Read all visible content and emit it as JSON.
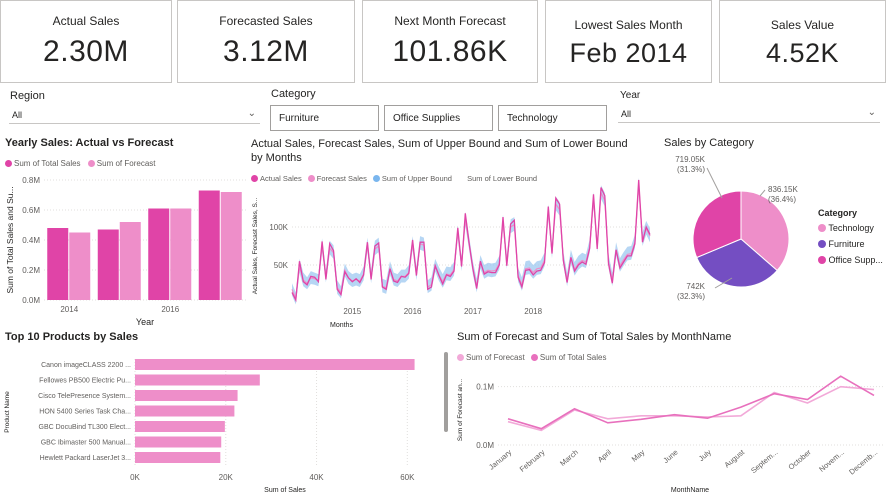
{
  "cards": [
    {
      "label": "Actual Sales",
      "value": "2.30M"
    },
    {
      "label": "Forecasted Sales",
      "value": "3.12M"
    },
    {
      "label": "Next Month Forecast",
      "value": "101.86K"
    },
    {
      "label": "Lowest Sales Month",
      "value": "Feb 2014"
    },
    {
      "label": "Sales Value",
      "value": "4.52K"
    }
  ],
  "slicers": {
    "region": {
      "title": "Region",
      "value": "All"
    },
    "category": {
      "title": "Category",
      "buttons": [
        "Furniture",
        "Office Supplies",
        "Technology"
      ]
    },
    "year": {
      "title": "Year",
      "value": "All"
    }
  },
  "icons": {
    "dropdown": "chevron-down-icon"
  },
  "colors": {
    "actual": "#e044a7",
    "forecast": "#ee8ec9",
    "upper": "#9dc8f0",
    "technology": "#ee8ec9",
    "furniture": "#744ec2",
    "office": "#e044a7"
  },
  "yearly": {
    "title": "Yearly Sales: Actual vs Forecast",
    "legend": [
      "Sum of Total Sales",
      "Sum of Forecast"
    ],
    "ylabel": "Sum of Total Sales and Su...",
    "xlabel": "Year",
    "yticks": [
      "0.0M",
      "0.2M",
      "0.4M",
      "0.6M",
      "0.8M"
    ],
    "xticks": [
      "2014",
      "2016"
    ]
  },
  "monthly": {
    "title": "Actual Sales, Forecast Sales, Sum of Upper Bound and Sum of Lower Bound by Months",
    "legend": [
      "Actual Sales",
      "Forecast Sales",
      "Sum of Upper Bound",
      "Sum of Lower Bound"
    ],
    "ylabel": "Actual Sales, Forecast Sales, S...",
    "xlabel": "Months",
    "yticks": [
      "50K",
      "100K"
    ],
    "xticks": [
      "2015",
      "2016",
      "2017",
      "2018"
    ]
  },
  "pie": {
    "title": "Sales by Category",
    "legend_title": "Category",
    "legend": [
      "Technology",
      "Furniture",
      "Office Supp..."
    ],
    "labels": [
      {
        "value": "836.15K",
        "pct": "(36.4%)"
      },
      {
        "value": "742K",
        "pct": "(32.3%)"
      },
      {
        "value": "719.05K",
        "pct": "(31.3%)"
      }
    ]
  },
  "top10": {
    "title": "Top 10 Products by Sales",
    "ylabel": "Product Name",
    "xlabel": "Sum of Sales",
    "xticks": [
      "0K",
      "20K",
      "40K",
      "60K"
    ]
  },
  "bymonth": {
    "title": "Sum of Forecast and Sum of Total Sales by MonthName",
    "legend": [
      "Sum of Forecast",
      "Sum of Total Sales"
    ],
    "ylabel": "Sum of Forecast an...",
    "xlabel": "MonthName",
    "yticks": [
      "0.0M",
      "0.1M"
    ]
  },
  "chart_data": [
    {
      "type": "bar",
      "categories": [
        "2014",
        "2015",
        "2016",
        "2017"
      ],
      "series": [
        {
          "name": "Sum of Total Sales",
          "values": [
            0.48,
            0.47,
            0.61,
            0.73
          ]
        },
        {
          "name": "Sum of Forecast",
          "values": [
            0.45,
            0.52,
            0.61,
            0.72
          ]
        }
      ],
      "ylim": [
        0,
        0.8
      ]
    },
    {
      "type": "line",
      "x_start": "2014-01",
      "series": [
        {
          "name": "Actual Sales",
          "values": [
            14,
            4,
            55,
            28,
            24,
            35,
            34,
            28,
            81,
            31,
            78,
            69,
            18,
            11,
            41,
            33,
            28,
            32,
            27,
            37,
            80,
            31,
            75,
            79,
            21,
            18,
            45,
            29,
            27,
            35,
            34,
            39,
            83,
            36,
            80,
            80,
            18,
            21,
            49,
            36,
            25,
            37,
            35,
            42,
            99,
            48,
            118,
            79,
            45,
            19,
            55,
            38,
            41,
            40,
            40,
            50,
            113,
            49,
            104,
            109,
            34,
            21,
            43,
            44,
            37,
            42,
            43,
            53,
            127,
            65,
            138,
            130,
            56,
            27,
            60,
            42,
            50,
            54,
            51,
            72,
            143,
            71,
            152,
            141,
            52,
            26,
            70,
            46,
            54,
            62,
            62,
            78,
            162,
            80,
            100,
            90
          ]
        },
        {
          "name": "Forecast Sales",
          "values": [
            18,
            6,
            48,
            30,
            26,
            33,
            32,
            30,
            75,
            35,
            72,
            66,
            20,
            14,
            43,
            33,
            29,
            31,
            29,
            38,
            76,
            34,
            71,
            75,
            22,
            20,
            45,
            31,
            29,
            35,
            35,
            40,
            78,
            38,
            78,
            76,
            21,
            24,
            49,
            37,
            28,
            38,
            37,
            44,
            93,
            50,
            110,
            78,
            45,
            22,
            53,
            40,
            43,
            42,
            43,
            52,
            106,
            53,
            100,
            103,
            36,
            24,
            45,
            46,
            40,
            45,
            46,
            56,
            120,
            67,
            130,
            123,
            58,
            30,
            60,
            44,
            52,
            56,
            54,
            74,
            136,
            74,
            145,
            135,
            54,
            30,
            70,
            49,
            57,
            64,
            65,
            80,
            155,
            83,
            98,
            88
          ]
        },
        {
          "name": "Sum of Upper Bound",
          "values": [
            26,
            14,
            58,
            40,
            34,
            42,
            40,
            38,
            85,
            44,
            82,
            76,
            30,
            22,
            52,
            42,
            38,
            40,
            38,
            48,
            86,
            44,
            82,
            86,
            32,
            30,
            55,
            40,
            38,
            44,
            44,
            50,
            88,
            48,
            88,
            86,
            30,
            34,
            58,
            47,
            38,
            48,
            47,
            54,
            102,
            60,
            120,
            88,
            55,
            32,
            63,
            50,
            53,
            52,
            53,
            62,
            116,
            63,
            110,
            113,
            46,
            34,
            55,
            56,
            50,
            55,
            56,
            66,
            130,
            77,
            140,
            133,
            68,
            40,
            70,
            54,
            62,
            66,
            64,
            84,
            146,
            84,
            155,
            145,
            64,
            40,
            80,
            59,
            67,
            74,
            75,
            90,
            165,
            93,
            108,
            98
          ]
        },
        {
          "name": "Sum of Lower Bound",
          "values": [
            10,
            -2,
            40,
            22,
            18,
            25,
            24,
            22,
            67,
            27,
            64,
            58,
            12,
            6,
            35,
            25,
            21,
            23,
            21,
            30,
            68,
            26,
            63,
            67,
            14,
            12,
            37,
            23,
            21,
            27,
            27,
            32,
            70,
            30,
            70,
            68,
            13,
            16,
            41,
            29,
            20,
            30,
            29,
            36,
            85,
            42,
            102,
            70,
            37,
            14,
            45,
            32,
            35,
            34,
            35,
            44,
            98,
            45,
            92,
            95,
            28,
            16,
            37,
            38,
            32,
            37,
            38,
            48,
            112,
            59,
            122,
            115,
            50,
            22,
            52,
            36,
            44,
            48,
            46,
            66,
            128,
            66,
            137,
            127,
            46,
            22,
            62,
            41,
            49,
            56,
            57,
            72,
            147,
            75,
            90,
            80
          ]
        }
      ],
      "ylim": [
        0,
        150
      ]
    },
    {
      "type": "pie",
      "categories": [
        "Technology",
        "Furniture",
        "Office Supplies"
      ],
      "values": [
        836.15,
        742,
        719.05
      ],
      "percent": [
        36.4,
        32.3,
        31.3
      ]
    },
    {
      "type": "bar",
      "orientation": "horizontal",
      "categories": [
        "Canon imageCLASS 2200 ...",
        "Fellowes PB500 Electric Pu...",
        "Cisco TelePresence System...",
        "HON 5400 Series Task Cha...",
        "GBC DocuBind TL300 Elect...",
        "GBC Ibimaster 500 Manual...",
        "Hewlett Packard LaserJet 3..."
      ],
      "values": [
        61.6,
        27.5,
        22.6,
        21.9,
        19.8,
        19.0,
        18.8
      ],
      "xlim": [
        0,
        65
      ]
    },
    {
      "type": "line",
      "categories": [
        "January",
        "February",
        "March",
        "April",
        "May",
        "June",
        "July",
        "August",
        "Septem...",
        "October",
        "Novem...",
        "Decemb..."
      ],
      "series": [
        {
          "name": "Sum of Forecast",
          "values": [
            0.04,
            0.025,
            0.06,
            0.045,
            0.05,
            0.05,
            0.048,
            0.05,
            0.09,
            0.072,
            0.1,
            0.095
          ]
        },
        {
          "name": "Sum of Total Sales",
          "values": [
            0.045,
            0.028,
            0.062,
            0.038,
            0.044,
            0.052,
            0.046,
            0.065,
            0.088,
            0.078,
            0.118,
            0.085
          ]
        }
      ],
      "ylim": [
        0,
        0.12
      ]
    }
  ]
}
